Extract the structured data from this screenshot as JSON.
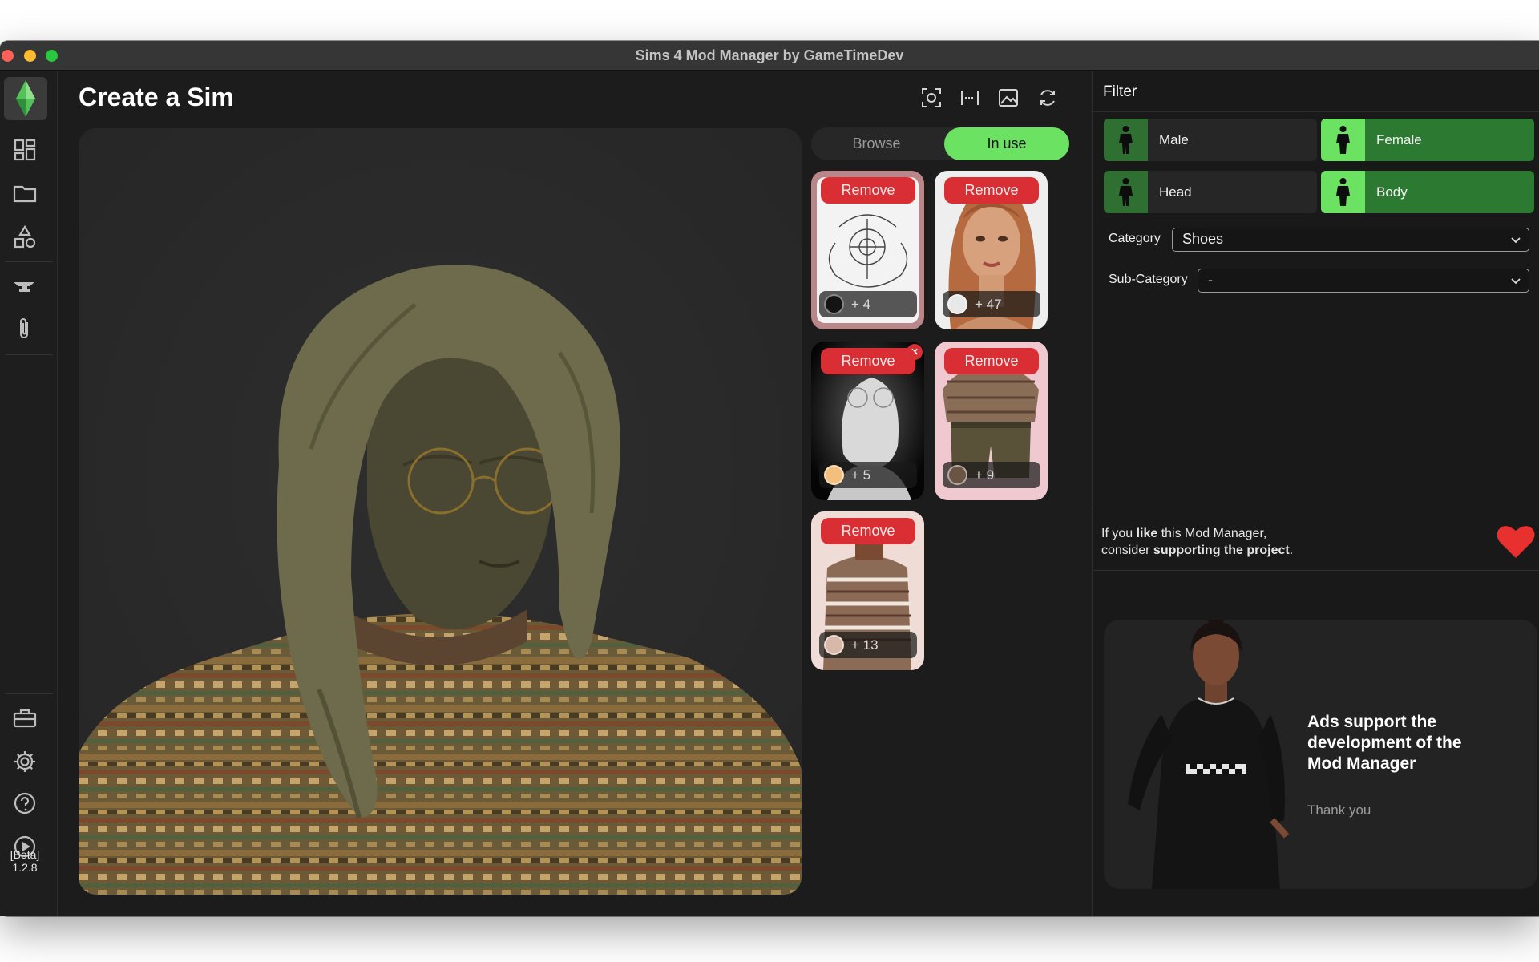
{
  "window": {
    "title": "Sims 4 Mod Manager by GameTimeDev"
  },
  "sidebar": {
    "items": [
      {
        "name": "dashboard-icon"
      },
      {
        "name": "folder-icon"
      },
      {
        "name": "shapes-icon"
      },
      {
        "name": "anvil-icon"
      },
      {
        "name": "paperclip-icon"
      },
      {
        "name": "toolbox-icon"
      },
      {
        "name": "gear-icon"
      },
      {
        "name": "help-icon"
      },
      {
        "name": "play-icon"
      }
    ],
    "version_tag": "[Beta]",
    "version_number": "1.2.8"
  },
  "page": {
    "title": "Create a Sim"
  },
  "toolbar": {
    "icons": [
      "capture-icon",
      "measure-icon",
      "image-icon",
      "refresh-icon"
    ]
  },
  "tabs": {
    "browse": "Browse",
    "in_use": "In use",
    "active": "In use"
  },
  "items": [
    {
      "remove_label": "Remove",
      "swatch_count": "+ 4",
      "swatch_color": "#141414"
    },
    {
      "remove_label": "Remove",
      "swatch_count": "+ 47",
      "swatch_color": "#e8e8e8"
    },
    {
      "remove_label": "Remove",
      "swatch_count": "+ 5",
      "swatch_color": "#f2c07c"
    },
    {
      "remove_label": "Remove",
      "swatch_count": "+ 9",
      "swatch_color": "#6a5444"
    },
    {
      "remove_label": "Remove",
      "swatch_count": "+ 13",
      "swatch_color": "#d8b8a8"
    }
  ],
  "filter": {
    "title": "Filter",
    "gender": [
      {
        "label": "Male",
        "selected": false
      },
      {
        "label": "Female",
        "selected": true
      }
    ],
    "region": [
      {
        "label": "Head",
        "selected": false
      },
      {
        "label": "Body",
        "selected": true
      }
    ],
    "category_label": "Category",
    "category_value": "Shoes",
    "subcategory_label": "Sub-Category",
    "subcategory_value": "-"
  },
  "support": {
    "line1_a": "If you ",
    "line1_b": "like",
    "line1_c": " this Mod Manager,",
    "line2_a": "consider ",
    "line2_b": "supporting the project",
    "line2_c": "."
  },
  "ad": {
    "heading": "Ads support the development of the Mod Manager",
    "thanks": "Thank you"
  },
  "colors": {
    "accent_green": "#6ce262",
    "selected_green": "#2c7a32",
    "remove_red": "#d92f34",
    "heart_red": "#e8302f"
  }
}
